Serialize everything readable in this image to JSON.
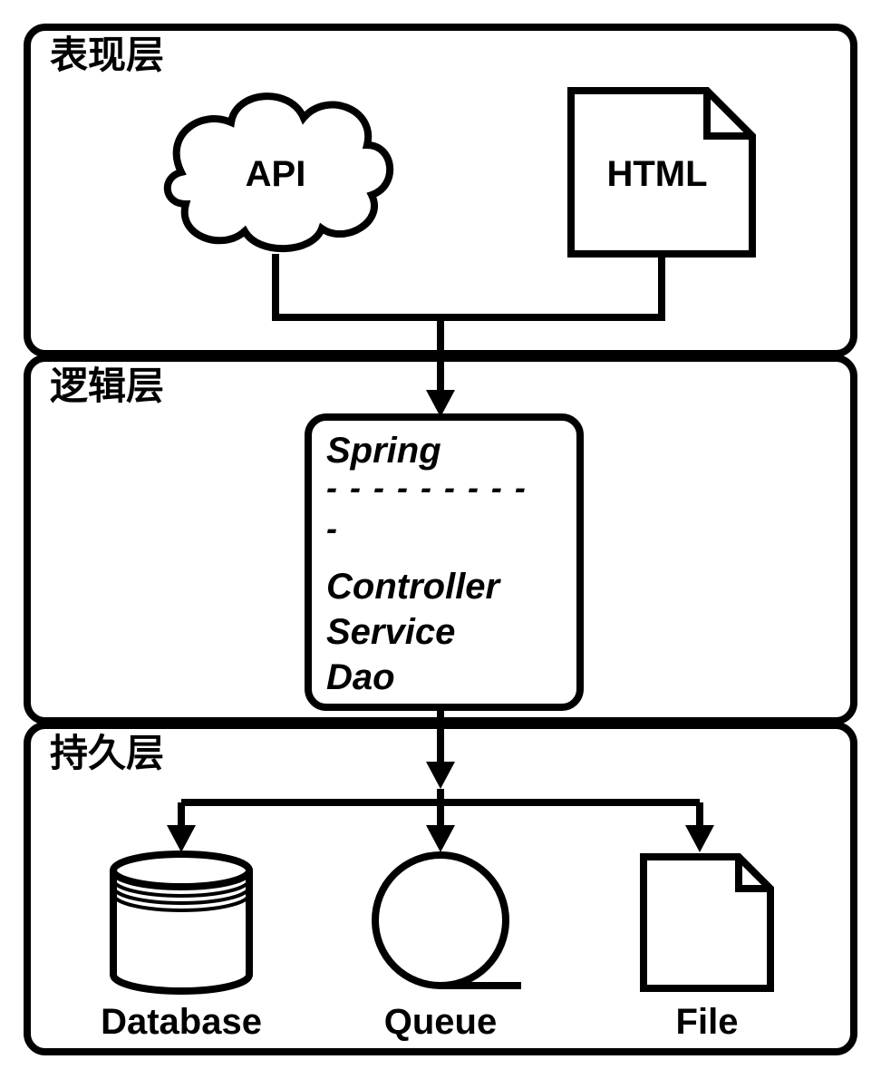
{
  "layers": {
    "presentation": {
      "title": "表现层",
      "api": "API",
      "html": "HTML"
    },
    "logic": {
      "title": "逻辑层",
      "framework": "Spring",
      "controller": "Controller",
      "service": "Service",
      "dao": "Dao"
    },
    "persistence": {
      "title": "持久层",
      "database": "Database",
      "queue": "Queue",
      "file": "File"
    }
  }
}
